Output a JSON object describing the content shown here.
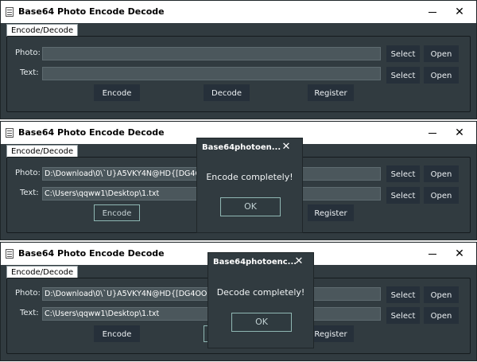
{
  "app_title": "Base64 Photo Encode Decode",
  "tab_label": "Encode/Decode",
  "photo_label": "Photo:",
  "text_label": "Text:",
  "select_label": "Select",
  "open_label": "Open",
  "encode_label": "Encode",
  "decode_label": "Decode",
  "register_label": "Register",
  "close_glyph": "✕",
  "windows": [
    {
      "photo_value": "",
      "text_value": ""
    },
    {
      "photo_value": "D:\\Download\\0\\`U}A5VKY4N@HD{[DG4OO5~B",
      "text_value": "C:\\Users\\qqww1\\Desktop\\1.txt"
    },
    {
      "photo_value": "D:\\Download\\0\\`U}A5VKY4N@HD{[DG4OO5~B.jp",
      "text_value": "C:\\Users\\qqww1\\Desktop\\1.txt"
    }
  ],
  "dialogs": [
    {
      "title": "Base64photoen...",
      "message": "Encode completely!",
      "ok_label": "OK"
    },
    {
      "title": "Base64photoenc...",
      "message": "Decode completely!",
      "ok_label": "OK"
    }
  ],
  "colors": {
    "background": "#313b40",
    "button": "#26303a",
    "accent_outline": "#8fb7b3",
    "field": "#4b575c"
  }
}
